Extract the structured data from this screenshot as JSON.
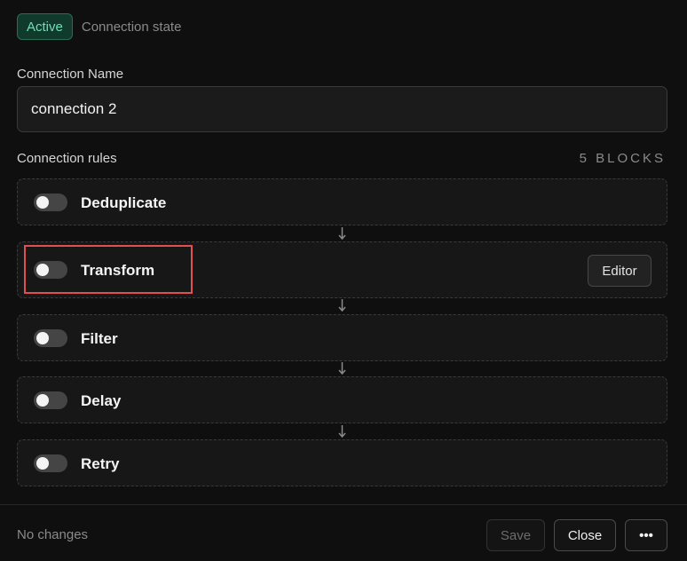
{
  "status": {
    "badge": "Active",
    "caption": "Connection state"
  },
  "connection_name": {
    "label": "Connection Name",
    "value": "connection 2"
  },
  "rules": {
    "label": "Connection rules",
    "count": "5 BLOCKS",
    "items": [
      {
        "name": "Deduplicate",
        "enabled": false
      },
      {
        "name": "Transform",
        "enabled": false,
        "action": "Editor"
      },
      {
        "name": "Filter",
        "enabled": false
      },
      {
        "name": "Delay",
        "enabled": false
      },
      {
        "name": "Retry",
        "enabled": false
      }
    ]
  },
  "footer": {
    "status": "No changes",
    "save": "Save",
    "close": "Close",
    "more": "•••"
  },
  "icons": {
    "connector": "arrow-down-icon",
    "more": "more-icon"
  },
  "colors": {
    "active_badge_bg": "#0f3a2c",
    "active_badge_text": "#6fe0b4",
    "highlight": "#e0504f"
  }
}
